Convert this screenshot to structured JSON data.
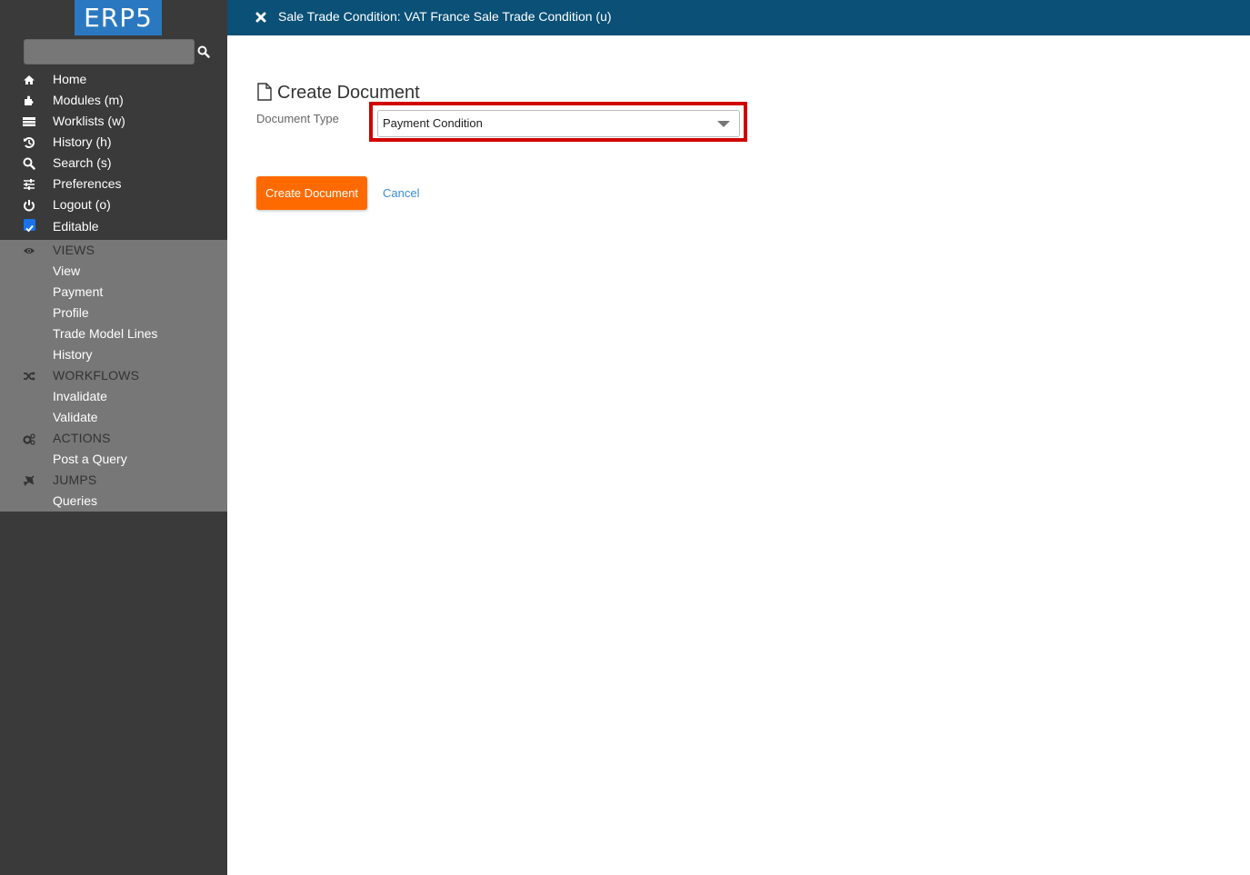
{
  "app": {
    "logo": "ERP5"
  },
  "search": {
    "placeholder": "",
    "value": ""
  },
  "header": {
    "title": "Sale Trade Condition: VAT France Sale Trade Condition (u)"
  },
  "nav": {
    "items": [
      {
        "label": "Home",
        "icon": "home-icon"
      },
      {
        "label": "Modules (m)",
        "icon": "puzzle-icon"
      },
      {
        "label": "Worklists (w)",
        "icon": "tasks-icon"
      },
      {
        "label": "History (h)",
        "icon": "history-icon"
      },
      {
        "label": "Search (s)",
        "icon": "search-icon"
      },
      {
        "label": "Preferences",
        "icon": "sliders-icon"
      },
      {
        "label": "Logout (o)",
        "icon": "power-icon"
      },
      {
        "label": "Editable",
        "icon": "checkbox",
        "checked": true
      }
    ]
  },
  "panel": {
    "views": {
      "label": "VIEWS",
      "icon": "eye-icon",
      "items": [
        "View",
        "Payment",
        "Profile",
        "Trade Model Lines",
        "History"
      ]
    },
    "workflows": {
      "label": "WORKFLOWS",
      "icon": "random-icon",
      "items": [
        "Invalidate",
        "Validate"
      ]
    },
    "actions": {
      "label": "ACTIONS",
      "icon": "cogs-icon",
      "items": [
        "Post a Query"
      ]
    },
    "jumps": {
      "label": "JUMPS",
      "icon": "plane-icon",
      "items": [
        "Queries"
      ]
    }
  },
  "main": {
    "title": "Create Document",
    "field_label": "Document Type",
    "document_type": "Payment Condition",
    "create_button": "Create Document",
    "cancel_link": "Cancel"
  },
  "colors": {
    "header_bg": "#0a5077",
    "sidebar_bg": "#3a3a3a",
    "panel_bg": "#777777",
    "logo_bg": "#2a79c0",
    "primary_button": "#ff6a00",
    "link": "#3c8cd9",
    "highlight": "#d00000"
  }
}
